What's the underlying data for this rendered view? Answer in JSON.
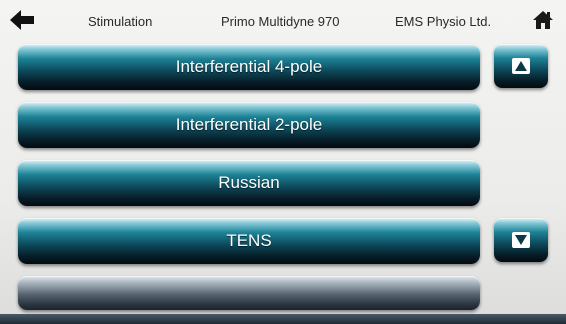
{
  "header": {
    "title": "Stimulation",
    "device": "Primo Multidyne 970",
    "company": "EMS Physio Ltd.",
    "back_icon": "back-arrow-icon",
    "home_icon": "home-icon"
  },
  "modes": [
    {
      "label": "Interferential 4-pole"
    },
    {
      "label": "Interferential 2-pole"
    },
    {
      "label": "Russian"
    },
    {
      "label": "TENS"
    },
    {
      "label": ""
    }
  ],
  "scroll": {
    "up_icon": "triangle-up-icon",
    "down_icon": "triangle-down-icon"
  },
  "colors": {
    "button_dark": "#0d4a5c",
    "button_highlight": "#7fc6d4",
    "background": "#f0f0ee",
    "header_text": "#2a2a2a"
  }
}
